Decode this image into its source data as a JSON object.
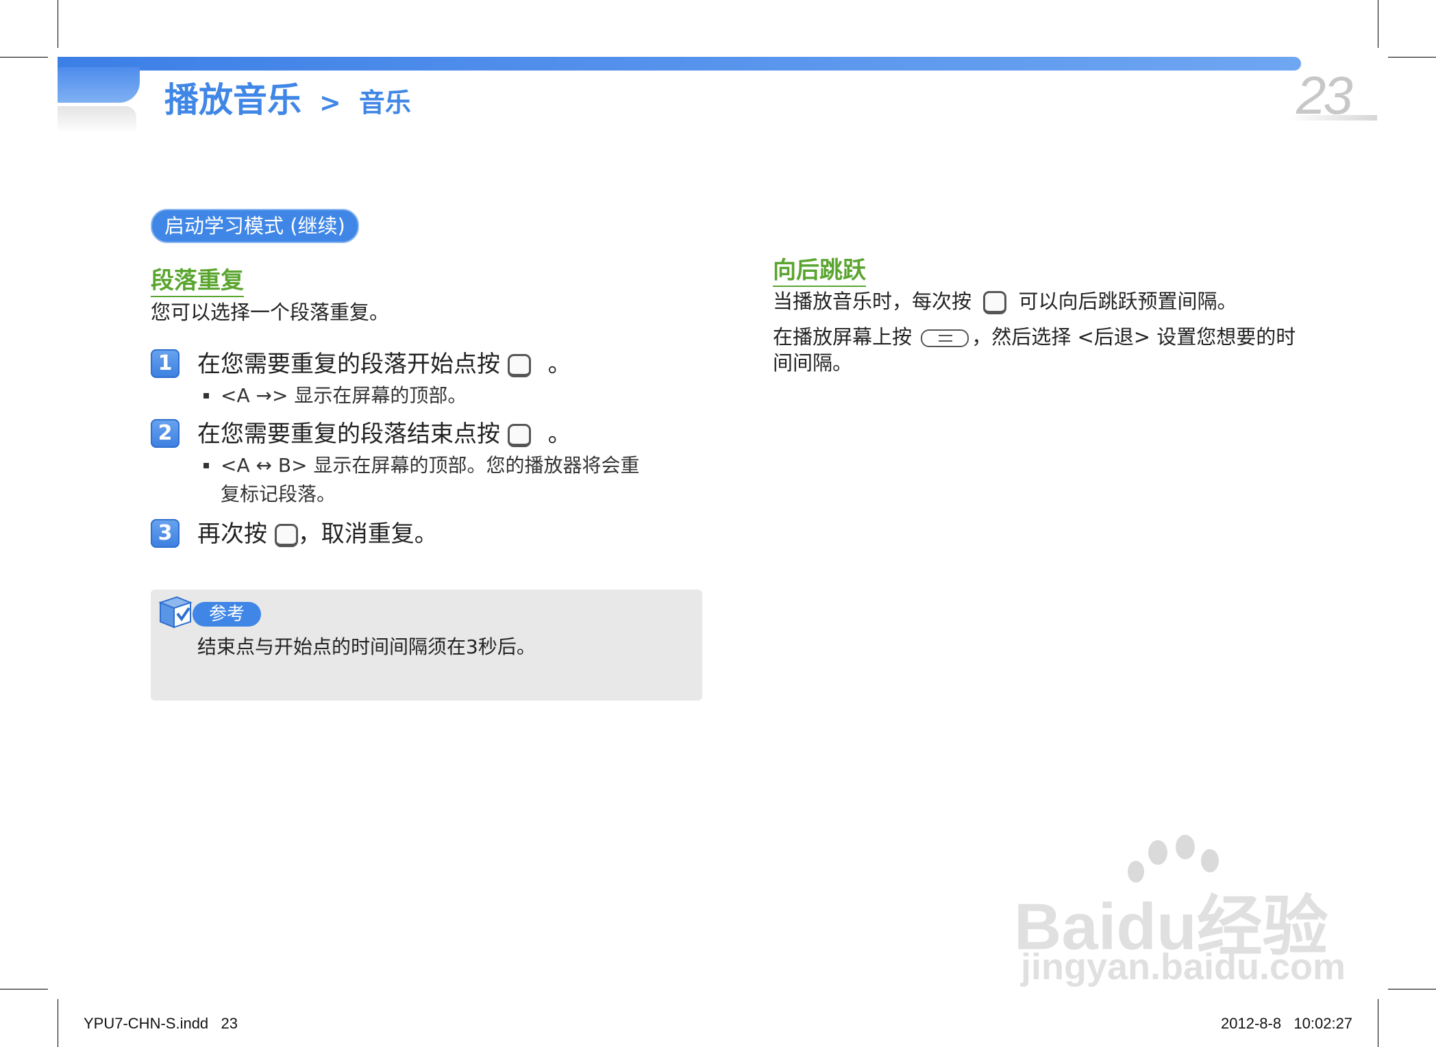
{
  "header": {
    "title": "播放音乐",
    "separator": ">",
    "subtitle": "音乐",
    "page_number": "23"
  },
  "section_pill": "启动学习模式 (继续)",
  "left": {
    "heading": "段落重复",
    "intro": "您可以选择一个段落重复。",
    "steps": [
      {
        "num": "1",
        "text_before": "在您需要重复的段落开始点按",
        "text_after": "。",
        "bullet": "<A →> 显示在屏幕的顶部。"
      },
      {
        "num": "2",
        "text_before": "在您需要重复的段落结束点按",
        "text_after": "。",
        "bullet_line1": "<A ↔ B> 显示在屏幕的顶部。您的播放器将会重",
        "bullet_line2": "复标记段落。"
      },
      {
        "num": "3",
        "text_before": "再次按",
        "text_after": "，取消重复。"
      }
    ],
    "note": {
      "label": "参考",
      "text": "结束点与开始点的时间间隔须在3秒后。"
    }
  },
  "right": {
    "heading": "向后跳跃",
    "line1_before": "当播放音乐时，每次按",
    "line1_after": "可以向后跳跃预置间隔。",
    "line2_before": "在播放屏幕上按",
    "line2_after": "，然后选择 <后退> 设置您想要的时",
    "line3": "间间隔。"
  },
  "footer": {
    "left": "YPU7-CHN-S.indd   23",
    "right": "2012-8-8   10:02:27"
  },
  "watermark": {
    "brand": "Baidu经验",
    "url": "jingyan.baidu.com"
  },
  "colors": {
    "accent_blue": "#3f86e6",
    "heading_green": "#5aa52f",
    "note_bg": "#e8e8e8"
  },
  "icons": [
    "button-icon",
    "menu-icon",
    "note-check-icon",
    "baidu-paw-icon"
  ]
}
